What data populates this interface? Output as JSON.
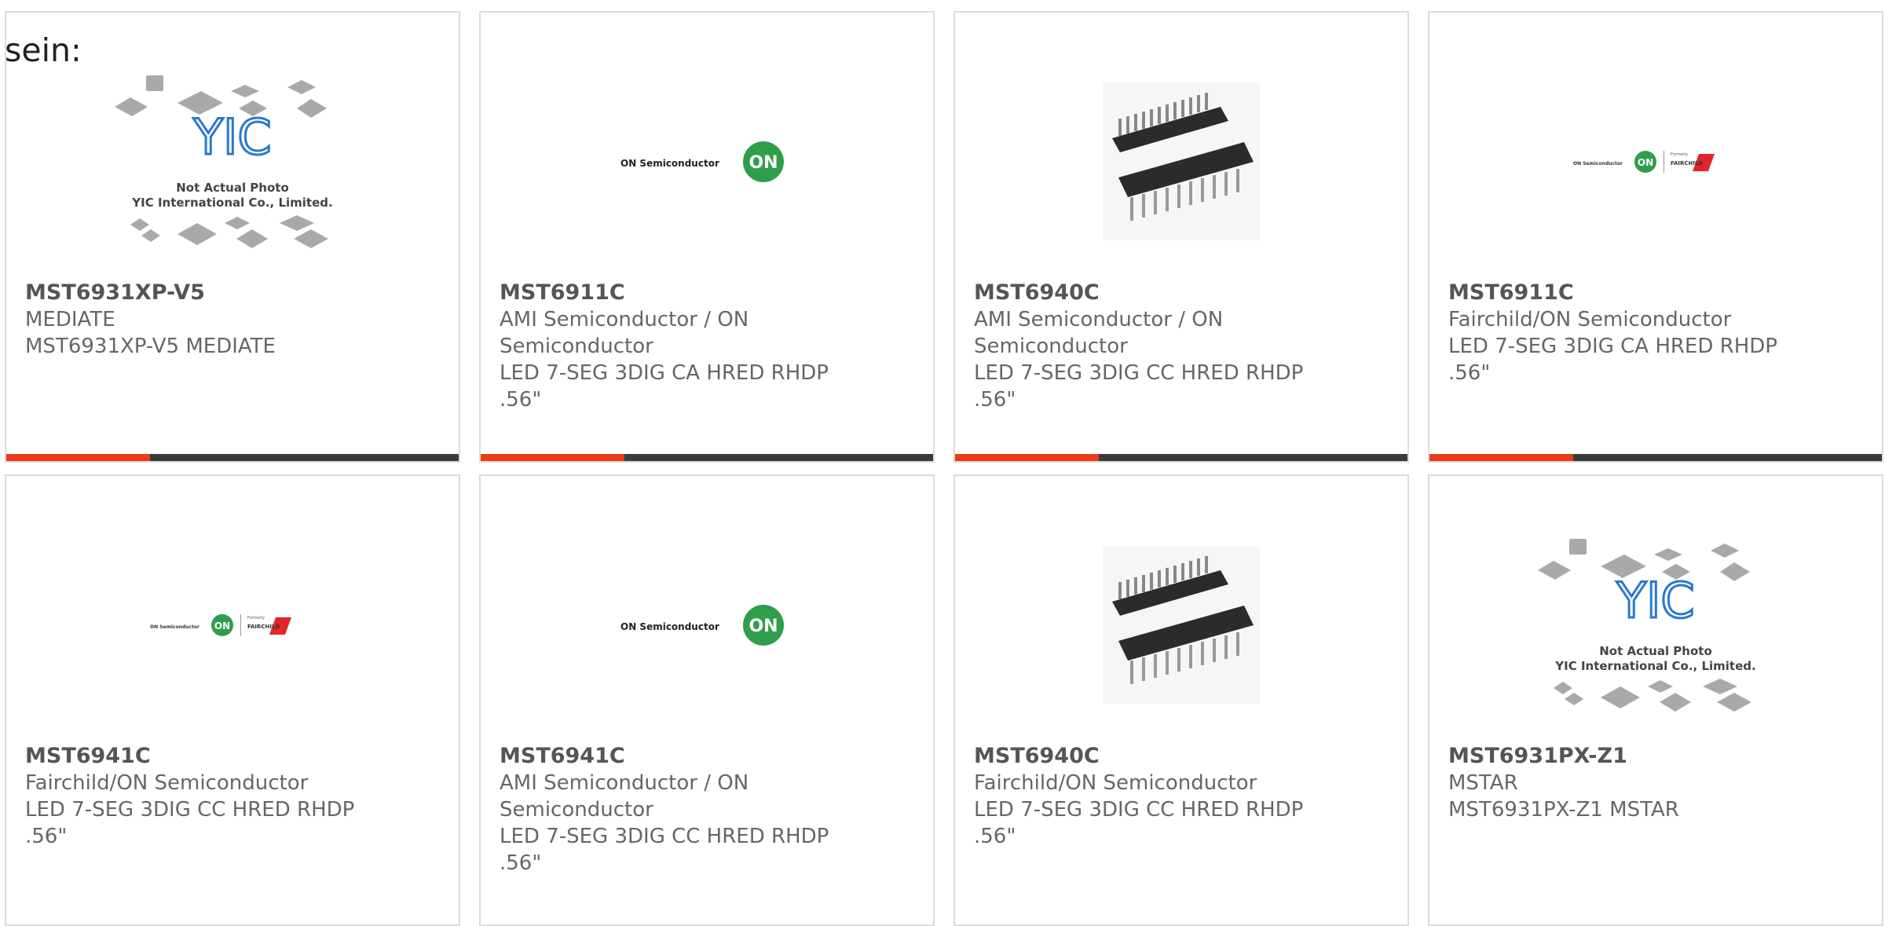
{
  "intro_text": "sein:",
  "placeholder_photo": {
    "line1": "Not Actual Photo",
    "line2": "YIC International Co., Limited.",
    "logo_text": "YIC"
  },
  "logos": {
    "on_semi": "ON Semiconductor",
    "on_badge": "ON",
    "formerly": "Formerly",
    "fairchild": "FAIRCHILD"
  },
  "colors": {
    "accent": "#ea3c16",
    "bar": "#3b3b3b",
    "on_green": "#2e9e4a"
  },
  "products": [
    {
      "part": "MST6931XP-V5",
      "maker": "MEDIATE",
      "desc": "MST6931XP-V5 MEDIATE",
      "image": "yic-placeholder"
    },
    {
      "part": "MST6911C",
      "maker": "AMI Semiconductor / ON Semiconductor",
      "desc": "LED 7-SEG 3DIG CA HRED RHDP .56\"",
      "image": "on-semi-logo"
    },
    {
      "part": "MST6940C",
      "maker": "AMI Semiconductor / ON Semiconductor",
      "desc": "LED 7-SEG 3DIG CC HRED RHDP .56\"",
      "image": "dip-chip"
    },
    {
      "part": "MST6911C",
      "maker": "Fairchild/ON Semiconductor",
      "desc": "LED 7-SEG 3DIG CA HRED RHDP .56\"",
      "image": "on-fairchild-logo"
    },
    {
      "part": "MST6941C",
      "maker": "Fairchild/ON Semiconductor",
      "desc": "LED 7-SEG 3DIG CC HRED RHDP .56\"",
      "image": "on-fairchild-logo"
    },
    {
      "part": "MST6941C",
      "maker": "AMI Semiconductor / ON Semiconductor",
      "desc": "LED 7-SEG 3DIG CC HRED RHDP .56\"",
      "image": "on-semi-logo"
    },
    {
      "part": "MST6940C",
      "maker": "Fairchild/ON Semiconductor",
      "desc": "LED 7-SEG 3DIG CC HRED RHDP .56\"",
      "image": "dip-chip"
    },
    {
      "part": "MST6931PX-Z1",
      "maker": "MSTAR",
      "desc": "MST6931PX-Z1 MSTAR",
      "image": "yic-placeholder"
    }
  ]
}
